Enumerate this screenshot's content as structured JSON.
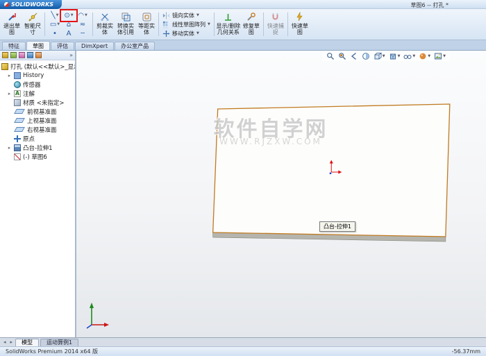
{
  "window": {
    "app_name": "SOLIDWORKS",
    "title": "草图6 -- 打孔 *"
  },
  "colors": {
    "logo_blue": "#0f5aa5",
    "highlight_red": "#e41414",
    "edge_orange": "#c07a20",
    "accent_blue": "#2d6db5"
  },
  "ribbon": {
    "exit_sketch": "退出草图",
    "smart_dimension": "智能尺寸",
    "entity_tools": [
      {
        "name": "line-tool",
        "glyph": "╲"
      },
      {
        "name": "circle-tool",
        "glyph": "⊙",
        "highlighted": true
      },
      {
        "name": "arc-tool",
        "glyph": "◠"
      },
      {
        "name": "rectangle-tool",
        "glyph": "▭"
      },
      {
        "name": "polygon-tool",
        "glyph": "⌂"
      },
      {
        "name": "spline-tool",
        "glyph": "≈"
      },
      {
        "name": "point-tool",
        "glyph": "•"
      },
      {
        "name": "text-tool",
        "glyph": "A"
      },
      {
        "name": "centerline-tool",
        "glyph": "╌"
      }
    ],
    "trim_entities": "剪裁实体",
    "convert_entities": "转换实体引用",
    "offset_entities": "等距实体",
    "mirror_entities": "镜向实体",
    "linear_pattern": "线性草图阵列",
    "move_entities": "移动实体",
    "display_delete_relations": "显示/删除几何关系",
    "repair_sketch": "修复草图",
    "quick_snaps": "快速捕捉",
    "rapid_sketch": "快速草图"
  },
  "command_tabs": {
    "items": [
      {
        "label": "特征",
        "active": false
      },
      {
        "label": "草图",
        "active": true
      },
      {
        "label": "评估",
        "active": false
      },
      {
        "label": "DimXpert",
        "active": false
      },
      {
        "label": "办公室产品",
        "active": false
      }
    ]
  },
  "manager_panel": {
    "tabs": [
      "featuremanager",
      "propertymanager",
      "configurationmanager",
      "dimxpertmanager",
      "displaymanager"
    ],
    "collapse_glyph": "»",
    "tree": {
      "items": [
        {
          "label": "打孔 (默认<<默认>_显示状态",
          "icon": "part"
        },
        {
          "label": "History",
          "icon": "history-folder"
        },
        {
          "label": "传感器",
          "icon": "sensors"
        },
        {
          "label": "注解",
          "icon": "annotations",
          "expandable": true
        },
        {
          "label": "材质 <未指定>",
          "icon": "material"
        },
        {
          "label": "前视基准面",
          "icon": "plane"
        },
        {
          "label": "上视基准面",
          "icon": "plane"
        },
        {
          "label": "右视基准面",
          "icon": "plane"
        },
        {
          "label": "原点",
          "icon": "origin"
        },
        {
          "label": "凸台-拉伸1",
          "icon": "extrude",
          "expandable": true
        },
        {
          "label": "(-) 草图6",
          "icon": "sketch"
        }
      ]
    }
  },
  "hud": {
    "icons": [
      "zoom-fit",
      "zoom-area",
      "previous-view",
      "section-view",
      "view-orientation",
      "display-style",
      "hide-show-items",
      "edit-appearance",
      "apply-scene"
    ]
  },
  "viewport": {
    "watermark_title": "软件自学网",
    "watermark_url": "WWW.RJZXW.COM",
    "tooltip_label": "凸台-拉伸1"
  },
  "model_tabs": {
    "nav_left": "◂",
    "nav_right": "▸",
    "items": [
      {
        "label": "模型",
        "active": true
      },
      {
        "label": "运动算例1",
        "active": false
      }
    ]
  },
  "status_bar": {
    "left": "SolidWorks Premium 2014 x64 版",
    "coordinate": "-56.37mm"
  }
}
